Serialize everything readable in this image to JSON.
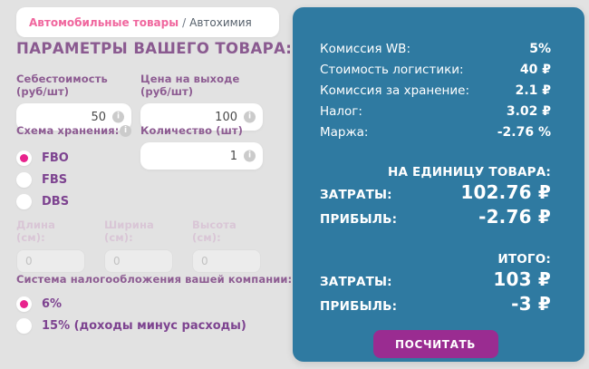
{
  "breadcrumb": {
    "category": "Автомобильные товары",
    "separator": "/",
    "subcategory": "Автохимия"
  },
  "form": {
    "title": "ПАРАМЕТРЫ ВАШЕГО ТОВАРА:",
    "cost": {
      "label": "Себестоимость (руб/шт)",
      "value": "50"
    },
    "price": {
      "label": "Цена на выходе (руб/шт)",
      "value": "100"
    },
    "storage": {
      "label": "Схема хранения:",
      "options": [
        {
          "label": "FBO",
          "selected": true
        },
        {
          "label": "FBS",
          "selected": false
        },
        {
          "label": "DBS",
          "selected": false
        }
      ]
    },
    "quantity": {
      "label": "Количество (шт)",
      "value": "1"
    },
    "dimensions": {
      "length_label": "Длина (см):",
      "width_label": "Ширина (см):",
      "height_label": "Высота (см):",
      "placeholder": "0"
    },
    "tax": {
      "label": "Система налогообложения вашей компании:",
      "options": [
        {
          "label": "6%",
          "selected": true
        },
        {
          "label": "15% (доходы минус расходы)",
          "selected": false
        }
      ]
    }
  },
  "icons": {
    "info": "i"
  },
  "results": {
    "rows": [
      {
        "label": "Комиссия WB:",
        "value": "5%"
      },
      {
        "label": "Стоимость логистики:",
        "value": "40 ₽"
      },
      {
        "label": "Комиссия за хранение:",
        "value": "2.1 ₽"
      },
      {
        "label": "Налог:",
        "value": "3.02 ₽"
      },
      {
        "label": "Маржа:",
        "value": "-2.76 %"
      }
    ],
    "per_unit": {
      "header": "НА ЕДИНИЦУ ТОВАРА:",
      "costs_label": "ЗАТРАТЫ:",
      "costs_value": "102.76 ₽",
      "profit_label": "ПРИБЫЛЬ:",
      "profit_value": "-2.76 ₽"
    },
    "total": {
      "header": "ИТОГО:",
      "costs_label": "ЗАТРАТЫ:",
      "costs_value": "103 ₽",
      "profit_label": "ПРИБЫЛЬ:",
      "profit_value": "-3 ₽"
    },
    "button_label": "ПОСЧИТАТЬ"
  },
  "colors": {
    "page_background": "#e2e2e2",
    "accent_pink": "#e8238d",
    "label_purple": "#8d5c92",
    "breadcrumb_pink": "#f0679e",
    "panel_teal": "#2f7aa1",
    "button_magenta": "#9a2c91"
  }
}
